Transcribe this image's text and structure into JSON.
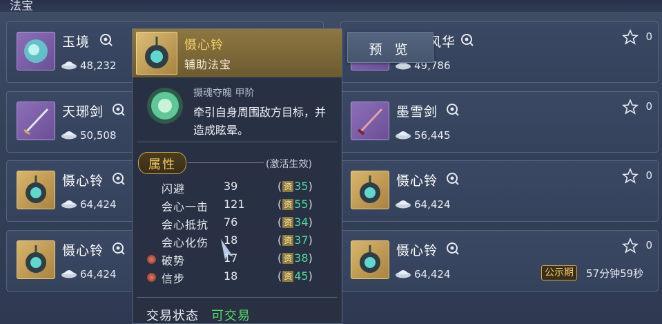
{
  "header": {
    "title": "法宝"
  },
  "preview_button": {
    "label": "预 览"
  },
  "items": [
    {
      "name": "玉境",
      "price": "48,232",
      "thumb": "purple"
    },
    {
      "name": "风华",
      "price": "49,786",
      "favorites": "0",
      "thumb": "purple"
    },
    {
      "name": "天琊剑",
      "price": "50,508",
      "thumb": "purple"
    },
    {
      "name": "墨雪剑",
      "price": "56,445",
      "favorites": "0",
      "thumb": "purple"
    },
    {
      "name": "慑心铃",
      "price": "64,424",
      "thumb": "gold"
    },
    {
      "name": "慑心铃",
      "price": "64,424",
      "favorites": "0",
      "thumb": "gold"
    },
    {
      "name": "慑心铃",
      "price": "64,424",
      "thumb": "gold"
    },
    {
      "name": "慑心铃",
      "price": "64,424",
      "favorites": "0",
      "thumb": "gold",
      "badge": "公示期",
      "countdown": "57分钟59秒"
    }
  ],
  "tooltip": {
    "name": "慑心铃",
    "type": "辅助法宝",
    "skill_name": "摄魂夺魄 甲阶",
    "skill_desc": "牵引自身周围敌方目标，并造成眩晕。",
    "attr_title": "属性",
    "activate_note": "(激活生效)",
    "grade_char": "资",
    "stats": [
      {
        "label": "闪避",
        "value": "39",
        "grade": "35",
        "special": false
      },
      {
        "label": "会心一击",
        "value": "121",
        "grade": "55",
        "special": false
      },
      {
        "label": "会心抵抗",
        "value": "76",
        "grade": "34",
        "special": false
      },
      {
        "label": "会心化伤",
        "value": "18",
        "grade": "37",
        "special": false
      },
      {
        "label": "破势",
        "value": "17",
        "grade": "38",
        "special": true
      },
      {
        "label": "信步",
        "value": "18",
        "grade": "45",
        "special": true
      }
    ],
    "trade_label": "交易状态",
    "trade_value": "可交易"
  },
  "colors": {
    "gold": "#f1c85e",
    "green_grade": "#52d6a2",
    "tradable": "#58d86a"
  }
}
